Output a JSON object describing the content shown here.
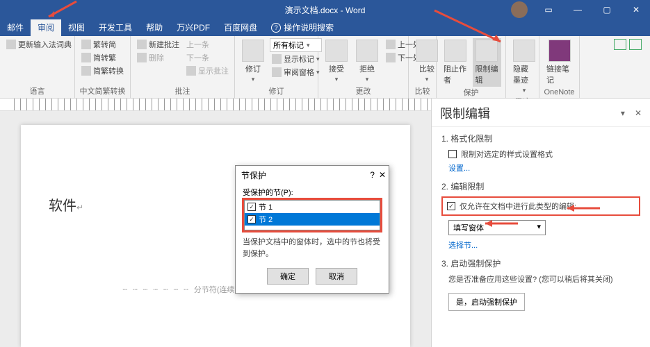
{
  "titlebar": {
    "title": "演示文档.docx - Word"
  },
  "tabs": [
    "邮件",
    "审阅",
    "视图",
    "开发工具",
    "帮助",
    "万兴PDF",
    "百度网盘"
  ],
  "tabs_active_index": 1,
  "tell_me": "操作说明搜索",
  "ribbon": {
    "language": {
      "label": "语言",
      "update_ime": "更新输入法词典"
    },
    "chinese_conv": {
      "label": "中文简繁转换",
      "simp_to_trad": "繁转简",
      "trad_to_simp": "简转繁",
      "simp_trad_conv": "简繁转换"
    },
    "comments": {
      "label": "批注",
      "new_comment": "新建批注",
      "delete": "删除",
      "prev": "上一条",
      "next": "下一条",
      "show_comments": "显示批注"
    },
    "tracking": {
      "label": "修订",
      "track": "修订",
      "markup_combo": "所有标记",
      "show_markup": "显示标记",
      "reviewing_pane": "审阅窗格"
    },
    "changes": {
      "label": "更改",
      "accept": "接受",
      "reject": "拒绝",
      "prev": "上一处",
      "next": "下一处"
    },
    "compare": {
      "label": "比较",
      "compare": "比较"
    },
    "protect": {
      "label": "保护",
      "block_authors": "阻止作者",
      "restrict_editing": "限制编辑"
    },
    "ink": {
      "label": "墨迹",
      "hide_ink": "隐藏墨迹"
    },
    "onenote": {
      "label": "OneNote",
      "linked_notes": "链接笔记"
    }
  },
  "document": {
    "visible_text": "软件",
    "section_break": "分节符(连续)"
  },
  "dialog": {
    "title": "节保护",
    "protected_sections_label": "受保护的节(P):",
    "sections": [
      {
        "label": "节 1",
        "checked": true,
        "selected": false
      },
      {
        "label": "节 2",
        "checked": true,
        "selected": true
      }
    ],
    "note": "当保护文档中的窗体时，选中的节也将受到保护。",
    "ok": "确定",
    "cancel": "取消"
  },
  "pane": {
    "title": "限制编辑",
    "sec1": {
      "heading": "1. 格式化限制",
      "checkbox_label": "限制对选定的样式设置格式",
      "settings_link": "设置..."
    },
    "sec2": {
      "heading": "2. 编辑限制",
      "checkbox_label": "仅允许在文档中进行此类型的编辑:",
      "combo_value": "填写窗体",
      "select_sections_link": "选择节..."
    },
    "sec3": {
      "heading": "3. 启动强制保护",
      "note": "您是否准备应用这些设置? (您可以稍后将其关闭)",
      "button": "是，启动强制保护"
    }
  }
}
